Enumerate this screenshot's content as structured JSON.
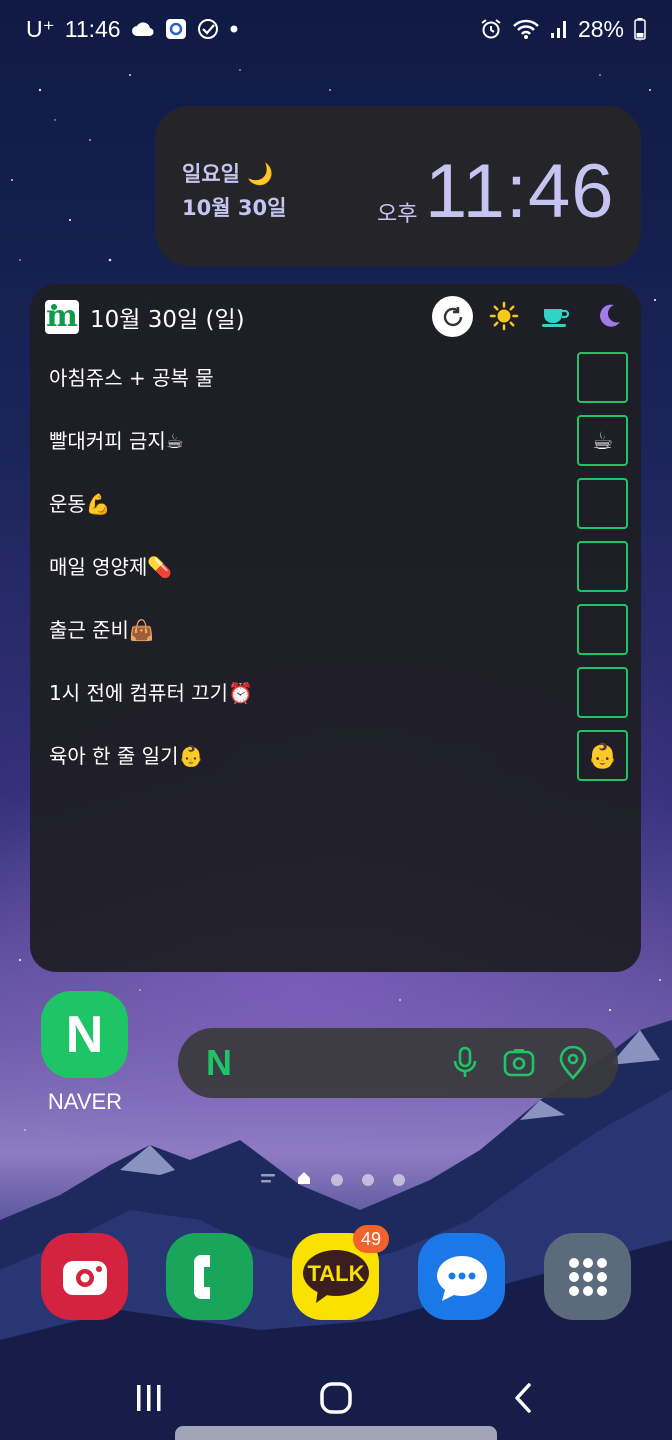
{
  "status_bar": {
    "carrier": "U⁺",
    "time": "11:46",
    "battery": "28%",
    "icons": [
      "cloud-icon",
      "app-notification-icon",
      "check-circle-icon",
      "dot-icon",
      "alarm-icon",
      "wifi-icon",
      "signal-icon",
      "battery-icon"
    ]
  },
  "clock_widget": {
    "day": "일요일 🌙",
    "date": "10월 30일",
    "ampm": "오후",
    "time": "11:46"
  },
  "todo_widget": {
    "title": "10월 30일 (일)",
    "header_icons": [
      "refresh-icon",
      "sun-icon",
      "coffee-cup-icon",
      "moon-icon"
    ],
    "items": [
      {
        "label": "아침쥬스 + 공복 물",
        "check": ""
      },
      {
        "label": "빨대커피 금지☕",
        "check": "☕"
      },
      {
        "label": "운동💪",
        "check": ""
      },
      {
        "label": "매일 영양제💊",
        "check": ""
      },
      {
        "label": "출근 준비👜",
        "check": ""
      },
      {
        "label": "1시 전에 컴퓨터 끄기⏰",
        "check": ""
      },
      {
        "label": "육아 한 줄 일기👶",
        "check": "👶"
      }
    ]
  },
  "naver_app": {
    "label": "NAVER",
    "icon_letter": "N"
  },
  "naver_search": {
    "logo": "N",
    "buttons": [
      "microphone-icon",
      "lens-camera-icon",
      "location-pin-icon"
    ]
  },
  "page_indicator": {
    "pages": 4,
    "current": 1
  },
  "dock": {
    "apps": [
      {
        "name": "camera",
        "color": "#d4233f"
      },
      {
        "name": "phone",
        "color": "#1aa65a"
      },
      {
        "name": "kakaotalk",
        "color": "#fae100",
        "badge": "49",
        "label_text": "TALK"
      },
      {
        "name": "messages",
        "color": "#1b78e8"
      },
      {
        "name": "apps",
        "color": "#5b6b7c"
      }
    ]
  },
  "colors": {
    "accent_green": "#20c466",
    "widget_bg": "#252529",
    "clock_text": "#c8c4f2"
  }
}
